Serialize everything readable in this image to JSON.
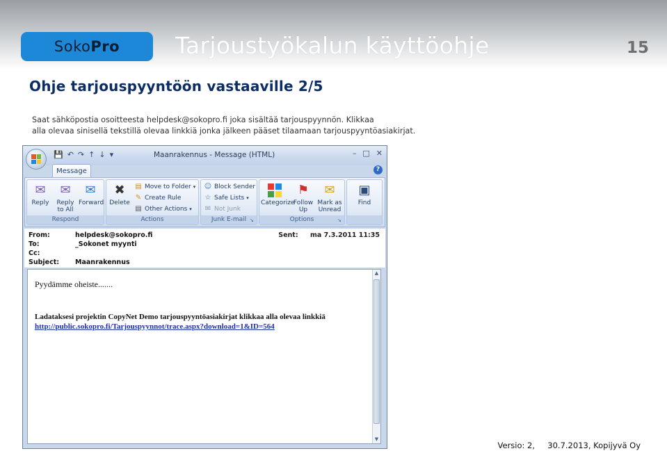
{
  "page": {
    "logo_soko": "Soko",
    "logo_pro": "Pro",
    "doc_title": "Tarjoustyökalun käyttöohje",
    "page_number": "15",
    "subtitle": "Ohje tarjouspyyntöön vastaaville 2/5",
    "intro_line1": "Saat sähköpostia osoitteesta helpdesk@sokopro.fi  joka sisältää tarjouspyynnön. Klikkaa",
    "intro_line2": "alla olevaa sinisellä tekstillä olevaa linkkiä jonka jälkeen pääset tilaamaan tarjouspyyntöasiakirjat.",
    "footer": "Versio: 2,     30.7.2013, Kopijyvä Oy"
  },
  "colors": {
    "logo_bg": "#1e88d8",
    "subtitle": "#0d2c63",
    "link": "#1a2fa8"
  },
  "outlook": {
    "window_title": "Maanrakennus - Message (HTML)",
    "tab_message": "Message",
    "groups": {
      "respond": {
        "label": "Respond",
        "reply": "Reply",
        "reply_all_1": "Reply",
        "reply_all_2": "to All",
        "forward": "Forward"
      },
      "actions": {
        "label": "Actions",
        "delete": "Delete",
        "move_to_folder": "Move to Folder",
        "create_rule": "Create Rule",
        "other_actions": "Other Actions"
      },
      "junk": {
        "label": "Junk E-mail",
        "block_sender": "Block Sender",
        "safe_lists": "Safe Lists",
        "not_junk": "Not Junk"
      },
      "options": {
        "label": "Options",
        "categorize": "Categorize",
        "follow_up_1": "Follow",
        "follow_up_2": "Up",
        "mark_unread_1": "Mark as",
        "mark_unread_2": "Unread"
      },
      "find": {
        "label": "Find"
      }
    },
    "headers": {
      "from_label": "From:",
      "from_value": "helpdesk@sokopro.fi",
      "to_label": "To:",
      "to_value": "_Sokonet myynti",
      "cc_label": "Cc:",
      "cc_value": "",
      "subject_label": "Subject:",
      "subject_value": "Maanrakennus",
      "sent_label": "Sent:",
      "sent_value": "ma 7.3.2011 11:35"
    },
    "body": {
      "greeting": "Pyydämme oheiste.......",
      "instruction": "Ladataksesi projektin CopyNet Demo tarjouspyyntöasiakirjat klikkaa alla olevaa linkkiä",
      "link": "http://public.sokopro.fi/Tarjouspyynnot/trace.aspx?download=1&ID=564"
    }
  }
}
